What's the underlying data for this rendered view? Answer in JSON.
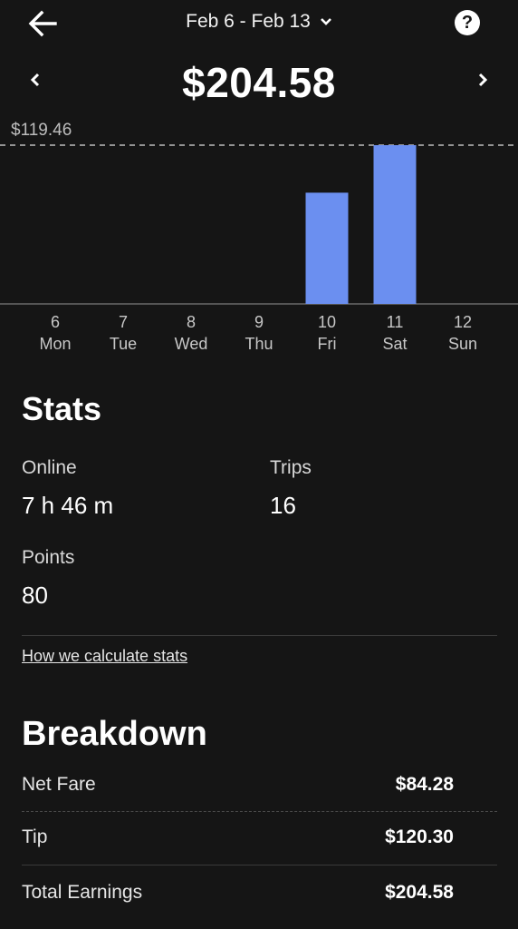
{
  "header": {
    "date_range": "Feb 6 - Feb 13",
    "total": "$204.58",
    "prev_icon": "chevron-left-icon",
    "next_icon": "chevron-right-icon",
    "back_icon": "arrow-left-icon",
    "help_icon": "help-icon"
  },
  "chart_data": {
    "type": "bar",
    "categories": [
      "6 Mon",
      "7 Tue",
      "8 Wed",
      "9 Thu",
      "10 Fri",
      "11 Sat",
      "12 Sun"
    ],
    "days": [
      {
        "num": "6",
        "name": "Mon"
      },
      {
        "num": "7",
        "name": "Tue"
      },
      {
        "num": "8",
        "name": "Wed"
      },
      {
        "num": "9",
        "name": "Thu"
      },
      {
        "num": "10",
        "name": "Fri"
      },
      {
        "num": "11",
        "name": "Sat"
      },
      {
        "num": "12",
        "name": "Sun"
      }
    ],
    "values": [
      0,
      0,
      0,
      0,
      84.28,
      120.3,
      0
    ],
    "max_label": "$119.46",
    "max_value": 119.46,
    "bar_color": "#6b8ff0",
    "title": "",
    "xlabel": "",
    "ylabel": ""
  },
  "stats": {
    "title": "Stats",
    "online_label": "Online",
    "online_value": "7 h 46 m",
    "trips_label": "Trips",
    "trips_value": "16",
    "points_label": "Points",
    "points_value": "80",
    "link": "How we calculate stats"
  },
  "breakdown": {
    "title": "Breakdown",
    "rows": [
      {
        "label": "Net Fare",
        "value": "$84.28"
      },
      {
        "label": "Tip",
        "value": "$120.30"
      },
      {
        "label": "Total Earnings",
        "value": "$204.58"
      }
    ]
  },
  "colors": {
    "background": "#151515",
    "accent": "#6b8ff0"
  }
}
